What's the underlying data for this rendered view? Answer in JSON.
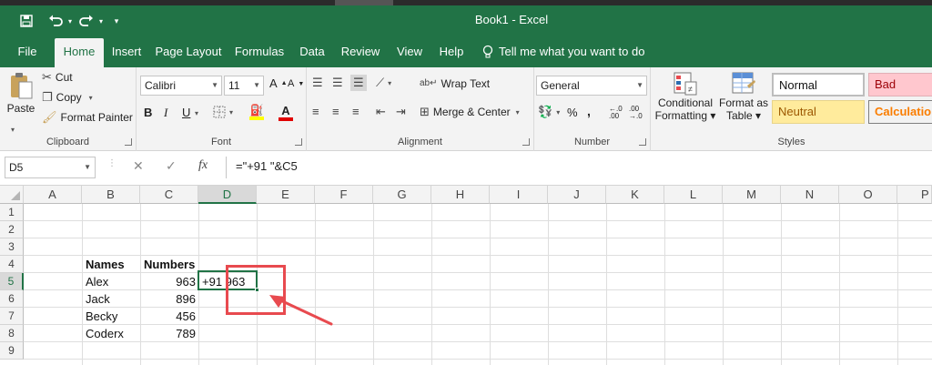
{
  "window": {
    "title": "Book1  -  Excel"
  },
  "quick_access": {
    "save_icon": "save-icon",
    "undo_icon": "undo-icon",
    "redo_icon": "redo-icon",
    "customize_icon": "customize-icon"
  },
  "tabs": [
    {
      "label": "File"
    },
    {
      "label": "Home"
    },
    {
      "label": "Insert"
    },
    {
      "label": "Page Layout"
    },
    {
      "label": "Formulas"
    },
    {
      "label": "Data"
    },
    {
      "label": "Review"
    },
    {
      "label": "View"
    },
    {
      "label": "Help"
    }
  ],
  "tell_me": "Tell me what you want to do",
  "ribbon": {
    "clipboard": {
      "label": "Clipboard",
      "paste": "Paste",
      "cut": "Cut",
      "copy": "Copy",
      "format_painter": "Format Painter"
    },
    "font": {
      "label": "Font",
      "font_name": "Calibri",
      "font_size": "11",
      "bold": "B",
      "italic": "I",
      "underline": "U"
    },
    "alignment": {
      "label": "Alignment",
      "wrap_text": "Wrap Text",
      "merge_center": "Merge & Center"
    },
    "number": {
      "label": "Number",
      "format": "General",
      "percent": "%",
      "comma": ","
    },
    "styles": {
      "label": "Styles",
      "conditional_formatting": [
        "Conditional",
        "Formatting"
      ],
      "format_as_table": [
        "Format as",
        "Table"
      ],
      "normal": "Normal",
      "bad": "Bad",
      "neutral": "Neutral",
      "calculation": "Calculation"
    }
  },
  "formula_bar": {
    "name_box": "D5",
    "fx": "fx",
    "formula": "=\"+91 \"&C5"
  },
  "grid": {
    "columns": [
      "A",
      "B",
      "C",
      "D",
      "E",
      "F",
      "G",
      "H",
      "I",
      "J",
      "K",
      "L",
      "M",
      "N",
      "O",
      "P"
    ],
    "rows": [
      "1",
      "2",
      "3",
      "4",
      "5",
      "6",
      "7",
      "8",
      "9"
    ],
    "selected_column": "D",
    "selected_row": "5",
    "headers": {
      "names": "Names",
      "numbers": "Numbers"
    },
    "data": [
      {
        "name": "Alex",
        "number": "963",
        "result": "+91 963"
      },
      {
        "name": "Jack",
        "number": "896"
      },
      {
        "name": "Becky",
        "number": "456"
      },
      {
        "name": "Coderx",
        "number": "789"
      }
    ]
  },
  "colors": {
    "excel_green": "#217346",
    "annotation_red": "#e84a4f"
  }
}
